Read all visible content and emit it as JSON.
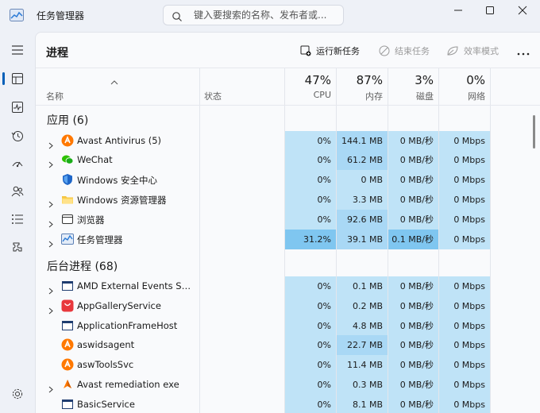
{
  "window": {
    "title": "任务管理器",
    "search_placeholder": "键入要搜索的名称、发布者或..."
  },
  "toolbar": {
    "page_title": "进程",
    "run_new_task": "运行新任务",
    "end_task": "结束任务",
    "efficiency_mode": "效率模式"
  },
  "columns": {
    "name": "名称",
    "status": "状态",
    "cpu": {
      "percent": "47%",
      "label": "CPU"
    },
    "memory": {
      "percent": "87%",
      "label": "内存"
    },
    "disk": {
      "percent": "3%",
      "label": "磁盘"
    },
    "network": {
      "percent": "0%",
      "label": "网络"
    }
  },
  "groups": {
    "apps": "应用 (6)",
    "background": "后台进程 (68)"
  },
  "apps": [
    {
      "name": "Avast Antivirus (5)",
      "icon": "avast-icon",
      "expandable": true,
      "cpu": "0%",
      "mem": "144.1 MB",
      "disk": "0 MB/秒",
      "net": "0 Mbps"
    },
    {
      "name": "WeChat",
      "icon": "wechat-icon",
      "expandable": true,
      "cpu": "0%",
      "mem": "61.2 MB",
      "disk": "0 MB/秒",
      "net": "0 Mbps"
    },
    {
      "name": "Windows 安全中心",
      "icon": "shield-icon",
      "expandable": false,
      "cpu": "0%",
      "mem": "0 MB",
      "disk": "0 MB/秒",
      "net": "0 Mbps"
    },
    {
      "name": "Windows 资源管理器",
      "icon": "folder-icon",
      "expandable": true,
      "cpu": "0%",
      "mem": "3.3 MB",
      "disk": "0 MB/秒",
      "net": "0 Mbps"
    },
    {
      "name": "浏览器",
      "icon": "browser-window-icon",
      "expandable": true,
      "cpu": "0%",
      "mem": "92.6 MB",
      "disk": "0 MB/秒",
      "net": "0 Mbps"
    },
    {
      "name": "任务管理器",
      "icon": "task-manager-icon",
      "expandable": true,
      "cpu": "31.2%",
      "mem": "39.1 MB",
      "disk": "0.1 MB/秒",
      "net": "0 Mbps"
    }
  ],
  "background": [
    {
      "name": "AMD External Events Servic...",
      "icon": "app-window-icon",
      "expandable": true,
      "cpu": "0%",
      "mem": "0.1 MB",
      "disk": "0 MB/秒",
      "net": "0 Mbps"
    },
    {
      "name": "AppGalleryService",
      "icon": "appgallery-icon",
      "expandable": true,
      "cpu": "0%",
      "mem": "0.2 MB",
      "disk": "0 MB/秒",
      "net": "0 Mbps"
    },
    {
      "name": "ApplicationFrameHost",
      "icon": "app-window-icon",
      "expandable": false,
      "cpu": "0%",
      "mem": "4.8 MB",
      "disk": "0 MB/秒",
      "net": "0 Mbps"
    },
    {
      "name": "aswidsagent",
      "icon": "avast-icon",
      "expandable": false,
      "cpu": "0%",
      "mem": "22.7 MB",
      "disk": "0 MB/秒",
      "net": "0 Mbps"
    },
    {
      "name": "aswToolsSvc",
      "icon": "avast-icon",
      "expandable": false,
      "cpu": "0%",
      "mem": "11.4 MB",
      "disk": "0 MB/秒",
      "net": "0 Mbps"
    },
    {
      "name": "Avast remediation exe",
      "icon": "avast-remediation-icon",
      "expandable": true,
      "cpu": "0%",
      "mem": "0.3 MB",
      "disk": "0 MB/秒",
      "net": "0 Mbps"
    },
    {
      "name": "BasicService",
      "icon": "app-window-icon",
      "expandable": false,
      "cpu": "0%",
      "mem": "8.1 MB",
      "disk": "0 MB/秒",
      "net": "0 Mbps"
    }
  ],
  "colors": {
    "accent": "#005fb8",
    "heat_low": "#bfe3f7",
    "heat_mid": "#a9d8f5",
    "heat_high": "#7fc6f0"
  }
}
